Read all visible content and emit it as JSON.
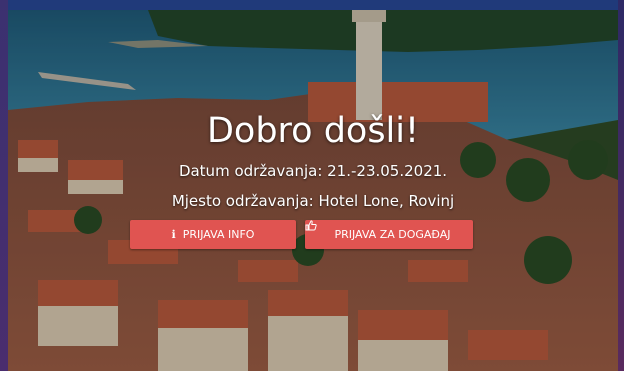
{
  "hero": {
    "title": "Dobro došli!",
    "date_line": "Datum održavanja: 21.-23.05.2021.",
    "location_line": "Mjesto održavanja: Hotel Lone, Rovinj"
  },
  "buttons": {
    "info_label": "PRIJAVA INFO",
    "info_icon": "info-icon",
    "event_label": "PRIJAVA ZA DOGAĐAJ",
    "event_icon": "thumbs-up-icon"
  },
  "colors": {
    "button": "#e05451",
    "sea": "#2f6f8e",
    "roof": "#b5583c"
  }
}
